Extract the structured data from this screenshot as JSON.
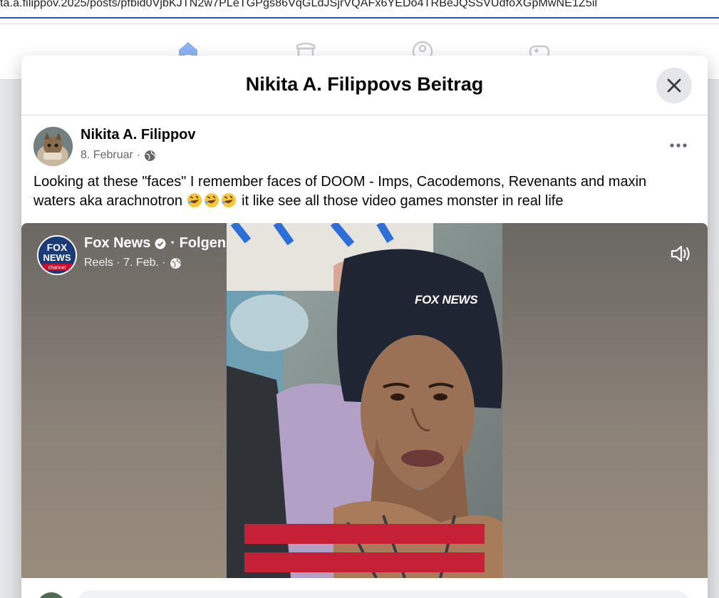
{
  "browser": {
    "url": "ta.a.filippov.2025/posts/pfbid0VjbKJTN2w7PLeTGPgs86VqGLdJSjrVQAFx6YEDo4TRBeJQSSVUdfoXGpMwNE1Z5il"
  },
  "nav": {
    "icons": [
      "home-icon",
      "marketplace-icon",
      "groups-icon",
      "gaming-icon"
    ]
  },
  "modal": {
    "title": "Nikita A. Filippovs Beitrag",
    "close_icon": "close-icon"
  },
  "post": {
    "author": "Nikita A. Filippov",
    "date": "8. Februar",
    "separator": "·",
    "privacy_icon": "globe-icon",
    "more_icon": "more-options-icon",
    "text_part1": "Looking at these \"faces\" I remember faces of DOOM - Imps, Cacodemons, Revenants and maxin waters aka arachnotron",
    "text_part2": "it like see all those video games monster in real life",
    "emoji": "rolling-on-floor-laughing-emoji"
  },
  "reel": {
    "source_name": "Fox News",
    "verified_icon": "verified-badge-icon",
    "follow_label": "· Folgen",
    "meta": "Reels · 7. Feb. ·",
    "sound_icon": "speaker-icon",
    "logo_line1": "FOX",
    "logo_line2": "NEWS",
    "logo_line3": "channel",
    "watermark": "FOX NEWS",
    "colors": {
      "fox_blue": "#1a3a78",
      "fox_red": "#c8102e",
      "banner_red": "#c52035"
    }
  }
}
